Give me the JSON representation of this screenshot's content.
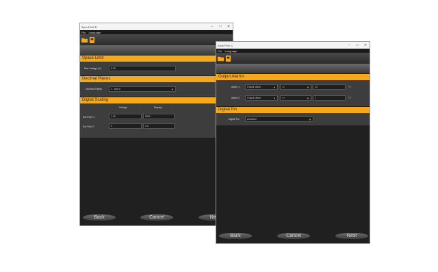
{
  "win1": {
    "title": "Zyon Pro2 B",
    "menu": [
      "File",
      "Language"
    ],
    "sec_input": {
      "title": "Space Limit",
      "label": "Max Voltage (V)",
      "value": "5.50"
    },
    "sec_decimal": {
      "title": "Decimal Places",
      "label": "Decimal Places",
      "value": "1 - ###.#"
    },
    "sec_scaling": {
      "title": "Digital Scaling",
      "col1": "Voltage",
      "col2": "Display",
      "row1_label": "Set Point 1",
      "row1_v": "1.25",
      "row1_d": "9801",
      "row2_label": "Set Point 2",
      "row2_v": "0",
      "row2_d": "0.0"
    },
    "back": "Back",
    "cancel": "Cancel",
    "next": "Next"
  },
  "win2": {
    "title": "Zyon Pro2 C",
    "menu": [
      "File",
      "Language"
    ],
    "sec_alarms": {
      "title": "Output Alarms",
      "a1_label": "Alarm 1",
      "a1_src": "Output Value",
      "a1_op": ">=",
      "a1_val": "10",
      "a1_unit": "°C",
      "a2_label": "Alarm 2",
      "a2_src": "Output Value",
      "a2_op": ">=",
      "a2_val": "2",
      "a2_unit": "°C"
    },
    "sec_pin": {
      "title": "Digital Pin",
      "label": "Digital Pin",
      "value": "Disabled"
    },
    "back": "Back",
    "cancel": "Cancel",
    "next": "Next"
  },
  "colors": {
    "accent": "#f6a81c",
    "panel": "#3d3d3d",
    "bg": "#202020"
  }
}
